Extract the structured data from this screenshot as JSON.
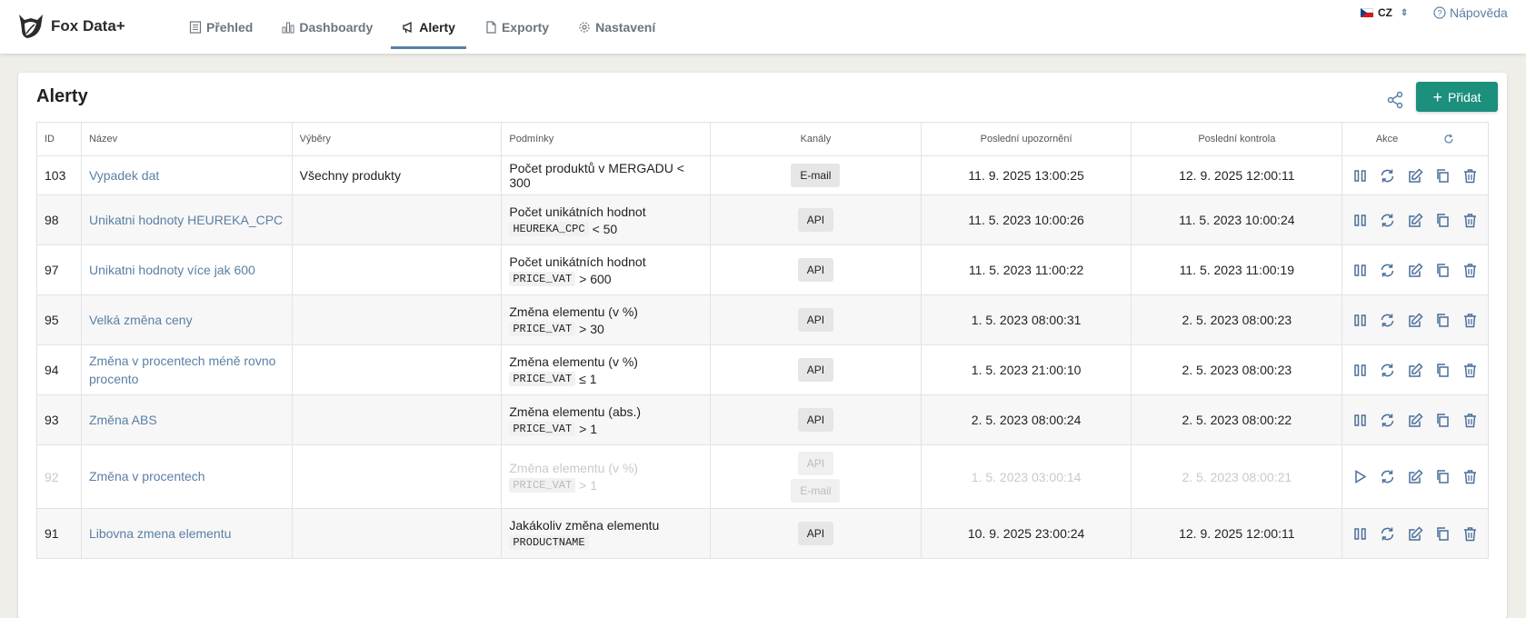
{
  "app": {
    "name": "Fox Data+"
  },
  "nav": {
    "items": [
      {
        "label": "Přehled",
        "icon": "document-list-icon",
        "active": false
      },
      {
        "label": "Dashboardy",
        "icon": "bar-chart-icon",
        "active": false
      },
      {
        "label": "Alerty",
        "icon": "megaphone-icon",
        "active": true
      },
      {
        "label": "Exporty",
        "icon": "file-icon",
        "active": false
      },
      {
        "label": "Nastavení",
        "icon": "gear-icon",
        "active": false
      }
    ],
    "language": "CZ",
    "help": "Nápověda"
  },
  "page": {
    "title": "Alerty",
    "add_label": "Přidat"
  },
  "table": {
    "headers": {
      "id": "ID",
      "name": "Název",
      "selections": "Výběry",
      "conditions": "Podmínky",
      "channels": "Kanály",
      "last_alert": "Poslední upozornění",
      "last_check": "Poslední kontrola",
      "actions": "Akce"
    },
    "rows": [
      {
        "id": "103",
        "name": "Vypadek dat",
        "selection": "Všechny produkty",
        "cond_text": "Počet produktů v MERGADU < 300",
        "cond_code": "",
        "cond_op": "",
        "channels": [
          "E-mail"
        ],
        "last_alert": "11. 9. 2025 13:00:25",
        "last_check": "12. 9. 2025 12:00:11",
        "state": "active"
      },
      {
        "id": "98",
        "name": "Unikatni hodnoty HEUREKA_CPC",
        "selection": "",
        "cond_text": "Počet unikátních hodnot",
        "cond_code": "HEUREKA_CPC",
        "cond_op": "< 50",
        "channels": [
          "API"
        ],
        "last_alert": "11. 5. 2023 10:00:26",
        "last_check": "11. 5. 2023 10:00:24",
        "state": "active"
      },
      {
        "id": "97",
        "name": "Unikatni hodnoty více jak 600",
        "selection": "",
        "cond_text": "Počet unikátních hodnot",
        "cond_code": "PRICE_VAT",
        "cond_op": "> 600",
        "channels": [
          "API"
        ],
        "last_alert": "11. 5. 2023 11:00:22",
        "last_check": "11. 5. 2023 11:00:19",
        "state": "active"
      },
      {
        "id": "95",
        "name": "Velká změna ceny",
        "selection": "",
        "cond_text": "Změna elementu (v %)",
        "cond_code": "PRICE_VAT",
        "cond_op": "> 30",
        "channels": [
          "API"
        ],
        "last_alert": "1. 5. 2023 08:00:31",
        "last_check": "2. 5. 2023 08:00:23",
        "state": "active"
      },
      {
        "id": "94",
        "name": "Změna v procentech méně rovno procento",
        "selection": "",
        "cond_text": "Změna elementu (v %)",
        "cond_code": "PRICE_VAT",
        "cond_op": "≤ 1",
        "channels": [
          "API"
        ],
        "last_alert": "1. 5. 2023 21:00:10",
        "last_check": "2. 5. 2023 08:00:23",
        "state": "active"
      },
      {
        "id": "93",
        "name": "Změna ABS",
        "selection": "",
        "cond_text": "Změna elementu (abs.)",
        "cond_code": "PRICE_VAT",
        "cond_op": "> 1",
        "channels": [
          "API"
        ],
        "last_alert": "2. 5. 2023 08:00:24",
        "last_check": "2. 5. 2023 08:00:22",
        "state": "active"
      },
      {
        "id": "92",
        "name": "Změna v procentech",
        "selection": "",
        "cond_text": "Změna elementu (v %)",
        "cond_code": "PRICE_VAT",
        "cond_op": "> 1",
        "channels": [
          "API",
          "E-mail"
        ],
        "last_alert": "1. 5. 2023 03:00:14",
        "last_check": "2. 5. 2023 08:00:21",
        "state": "paused"
      },
      {
        "id": "91",
        "name": "Libovna zmena elementu",
        "selection": "",
        "cond_text": "Jakákoliv změna elementu",
        "cond_code": "PRODUCTNAME",
        "cond_op": "",
        "channels": [
          "API"
        ],
        "last_alert": "10. 9. 2025 23:00:24",
        "last_check": "12. 9. 2025 12:00:11",
        "state": "active"
      }
    ]
  },
  "colors": {
    "accent": "#5a7fa6",
    "primary_button": "#1d8f7d"
  }
}
